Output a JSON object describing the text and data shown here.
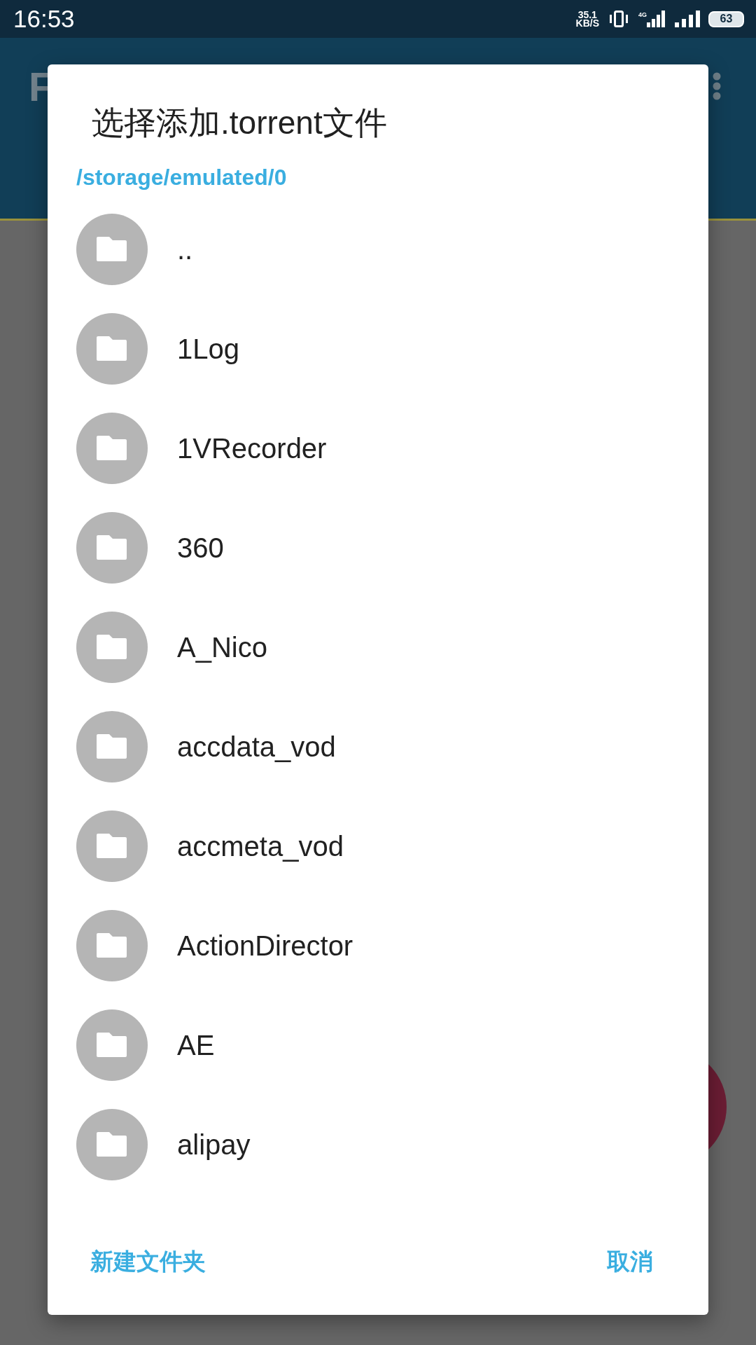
{
  "status_bar": {
    "time": "16:53",
    "net_speed": "35.1",
    "net_speed_unit": "KB/S",
    "network_type": "4G",
    "battery": "63"
  },
  "app_bar": {
    "title": "F"
  },
  "dialog": {
    "title": "选择添加.torrent文件",
    "path": "/storage/emulated/0",
    "items": [
      {
        "name": ".."
      },
      {
        "name": "1Log"
      },
      {
        "name": "1VRecorder"
      },
      {
        "name": "360"
      },
      {
        "name": "A_Nico"
      },
      {
        "name": "accdata_vod"
      },
      {
        "name": "accmeta_vod"
      },
      {
        "name": "ActionDirector"
      },
      {
        "name": "AE"
      },
      {
        "name": "alipay"
      }
    ],
    "buttons": [
      {
        "label": "新建文件夹"
      },
      {
        "label": "取消"
      }
    ]
  }
}
